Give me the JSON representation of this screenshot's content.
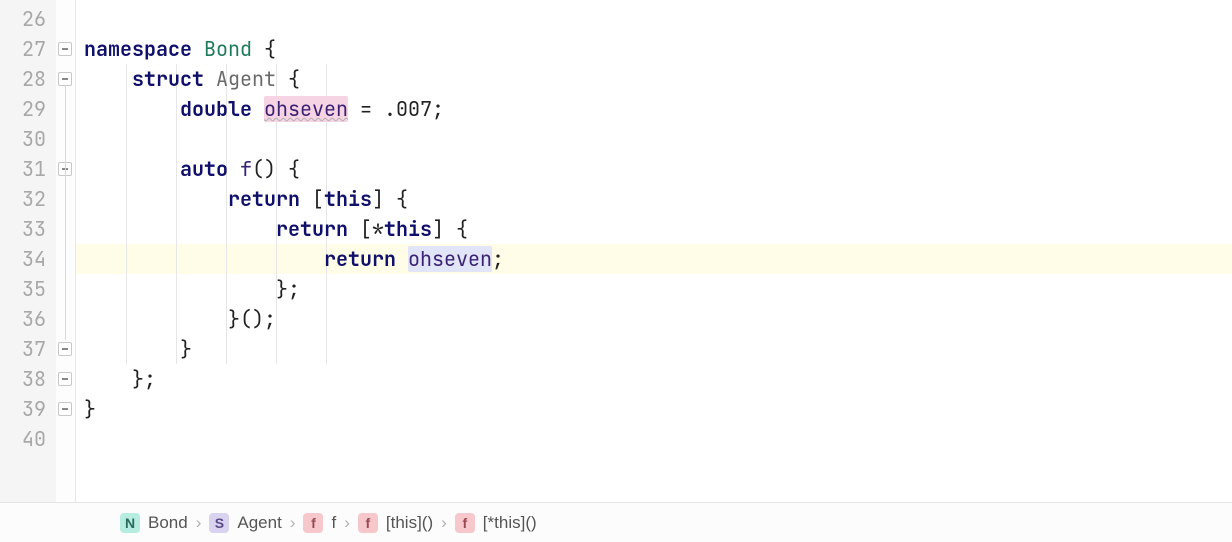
{
  "first_line_num": 26,
  "highlighted_line_num": 34,
  "lines": [
    {
      "tokens": []
    },
    {
      "tokens": [
        {
          "t": "namespace ",
          "c": "kw"
        },
        {
          "t": "Bond ",
          "c": "nm"
        },
        {
          "t": "{",
          "c": "op"
        }
      ]
    },
    {
      "tokens": [
        {
          "t": "    ",
          "c": ""
        },
        {
          "t": "struct ",
          "c": "kw"
        },
        {
          "t": "Agent ",
          "c": "ty"
        },
        {
          "t": "{",
          "c": "op"
        }
      ]
    },
    {
      "tokens": [
        {
          "t": "        ",
          "c": ""
        },
        {
          "t": "double ",
          "c": "kw"
        },
        {
          "t": "ohseven",
          "c": "id",
          "extra": "hl-pink wavy"
        },
        {
          "t": " = .007;",
          "c": "op"
        }
      ]
    },
    {
      "tokens": []
    },
    {
      "tokens": [
        {
          "t": "        ",
          "c": ""
        },
        {
          "t": "auto ",
          "c": "kw"
        },
        {
          "t": "f",
          "c": "id"
        },
        {
          "t": "() {",
          "c": "op"
        }
      ]
    },
    {
      "tokens": [
        {
          "t": "            ",
          "c": ""
        },
        {
          "t": "return ",
          "c": "kw"
        },
        {
          "t": "[",
          "c": "op"
        },
        {
          "t": "this",
          "c": "kw"
        },
        {
          "t": "] {",
          "c": "op"
        }
      ]
    },
    {
      "tokens": [
        {
          "t": "                ",
          "c": ""
        },
        {
          "t": "return ",
          "c": "kw"
        },
        {
          "t": "[*",
          "c": "op"
        },
        {
          "t": "this",
          "c": "kw"
        },
        {
          "t": "] {",
          "c": "op"
        }
      ]
    },
    {
      "tokens": [
        {
          "t": "                    ",
          "c": ""
        },
        {
          "t": "return ",
          "c": "kw"
        },
        {
          "t": "ohseven",
          "c": "id",
          "extra": "hl-blue"
        },
        {
          "t": ";",
          "c": "op"
        }
      ]
    },
    {
      "tokens": [
        {
          "t": "                ",
          "c": ""
        },
        {
          "t": "};",
          "c": "op"
        }
      ]
    },
    {
      "tokens": [
        {
          "t": "            ",
          "c": ""
        },
        {
          "t": "}();",
          "c": "op"
        }
      ]
    },
    {
      "tokens": [
        {
          "t": "        ",
          "c": ""
        },
        {
          "t": "}",
          "c": "op"
        }
      ]
    },
    {
      "tokens": [
        {
          "t": "    ",
          "c": ""
        },
        {
          "t": "};",
          "c": "op"
        }
      ]
    },
    {
      "tokens": [
        {
          "t": "}",
          "c": "op"
        }
      ]
    },
    {
      "tokens": []
    }
  ],
  "breadcrumb": [
    {
      "badge": "N",
      "cls": "b-n",
      "label": "Bond"
    },
    {
      "badge": "S",
      "cls": "b-s",
      "label": "Agent"
    },
    {
      "badge": "f",
      "cls": "b-f",
      "label": "f"
    },
    {
      "badge": "f",
      "cls": "b-f",
      "label": "[this]()"
    },
    {
      "badge": "f",
      "cls": "b-f",
      "label": "[*this]()"
    }
  ]
}
